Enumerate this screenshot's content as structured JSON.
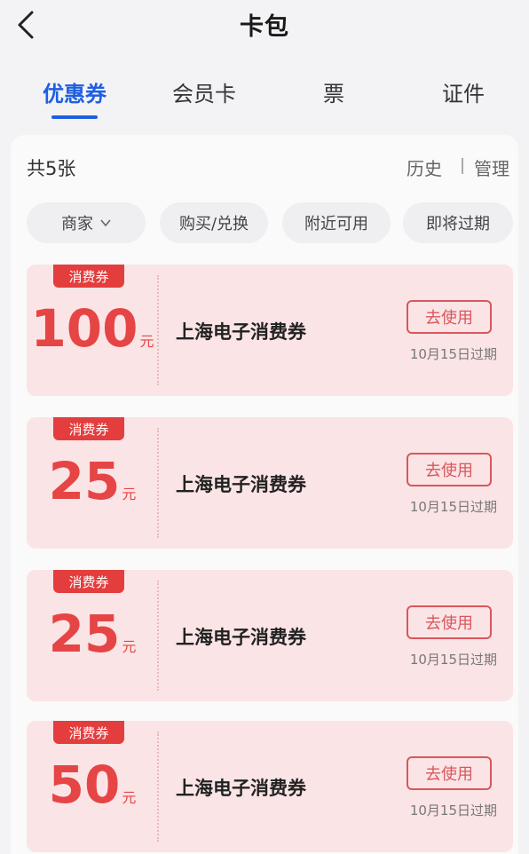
{
  "header": {
    "title": "卡包",
    "back_icon": "chevron-left-icon"
  },
  "tabs": [
    {
      "label": "优惠券",
      "active": true
    },
    {
      "label": "会员卡",
      "active": false
    },
    {
      "label": "票",
      "active": false
    },
    {
      "label": "证件",
      "active": false
    }
  ],
  "summary": {
    "count_text": "共5张",
    "history": "历史",
    "manage": "管理"
  },
  "filters": [
    {
      "label": "商家",
      "icon": "chevron-down-icon"
    },
    {
      "label": "购买/兑换"
    },
    {
      "label": "附近可用"
    },
    {
      "label": "即将过期"
    }
  ],
  "coupons": [
    {
      "tag": "消费券",
      "amount": "100",
      "unit": "元",
      "name": "上海电子消费券",
      "action": "去使用",
      "expire": "10月15日过期"
    },
    {
      "tag": "消费券",
      "amount": "25",
      "unit": "元",
      "name": "上海电子消费券",
      "action": "去使用",
      "expire": "10月15日过期"
    },
    {
      "tag": "消费券",
      "amount": "25",
      "unit": "元",
      "name": "上海电子消费券",
      "action": "去使用",
      "expire": "10月15日过期"
    },
    {
      "tag": "消费券",
      "amount": "50",
      "unit": "元",
      "name": "上海电子消费券",
      "action": "去使用",
      "expire": "10月15日过期"
    }
  ],
  "colors": {
    "accent": "#1f5fe0",
    "coupon_red": "#e64545",
    "coupon_bg": "#fbe4e6"
  }
}
